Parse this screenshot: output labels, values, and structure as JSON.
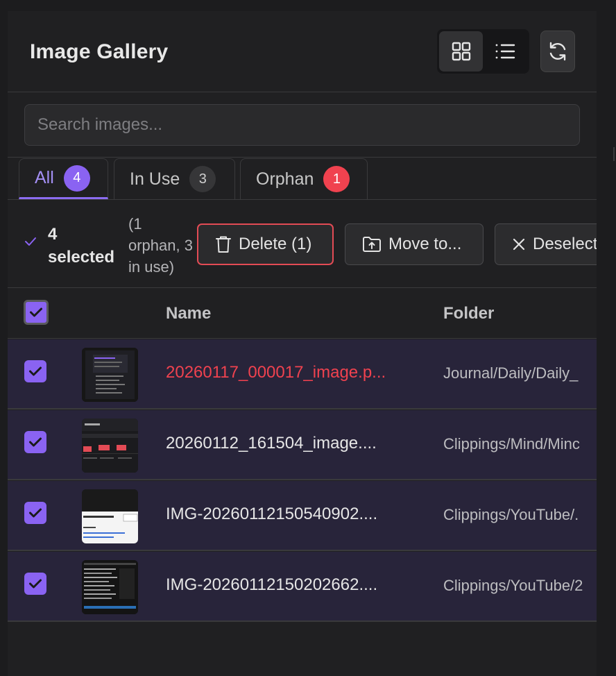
{
  "header": {
    "title": "Image Gallery",
    "grid_view_icon": "grid-icon",
    "list_view_icon": "list-icon",
    "refresh_icon": "refresh-icon"
  },
  "search": {
    "placeholder": "Search images...",
    "value": ""
  },
  "tabs": [
    {
      "label": "All",
      "count": "4",
      "active": true
    },
    {
      "label": "In Use",
      "count": "3",
      "active": false
    },
    {
      "label": "Orphan",
      "count": "1",
      "active": false
    }
  ],
  "selection": {
    "count_line1": "4",
    "count_line2": "selected",
    "detail": "(1 orphan, 3 in use)",
    "delete_label": "Delete (1)",
    "move_label": "Move to...",
    "deselect_label": "Deselect"
  },
  "table": {
    "columns": {
      "name": "Name",
      "folder": "Folder"
    },
    "rows": [
      {
        "name": "20260117_000017_image.p...",
        "folder": "Journal/Daily/Daily_",
        "orphan": true
      },
      {
        "name": "20260112_161504_image....",
        "folder": "Clippings/Mind/Minc",
        "orphan": false
      },
      {
        "name": "IMG-20260112150540902....",
        "folder": "Clippings/YouTube/.",
        "orphan": false
      },
      {
        "name": "IMG-20260112150202662....",
        "folder": "Clippings/YouTube/2",
        "orphan": false
      }
    ]
  },
  "colors": {
    "accent": "#8a63f2",
    "danger": "#f0424f"
  }
}
